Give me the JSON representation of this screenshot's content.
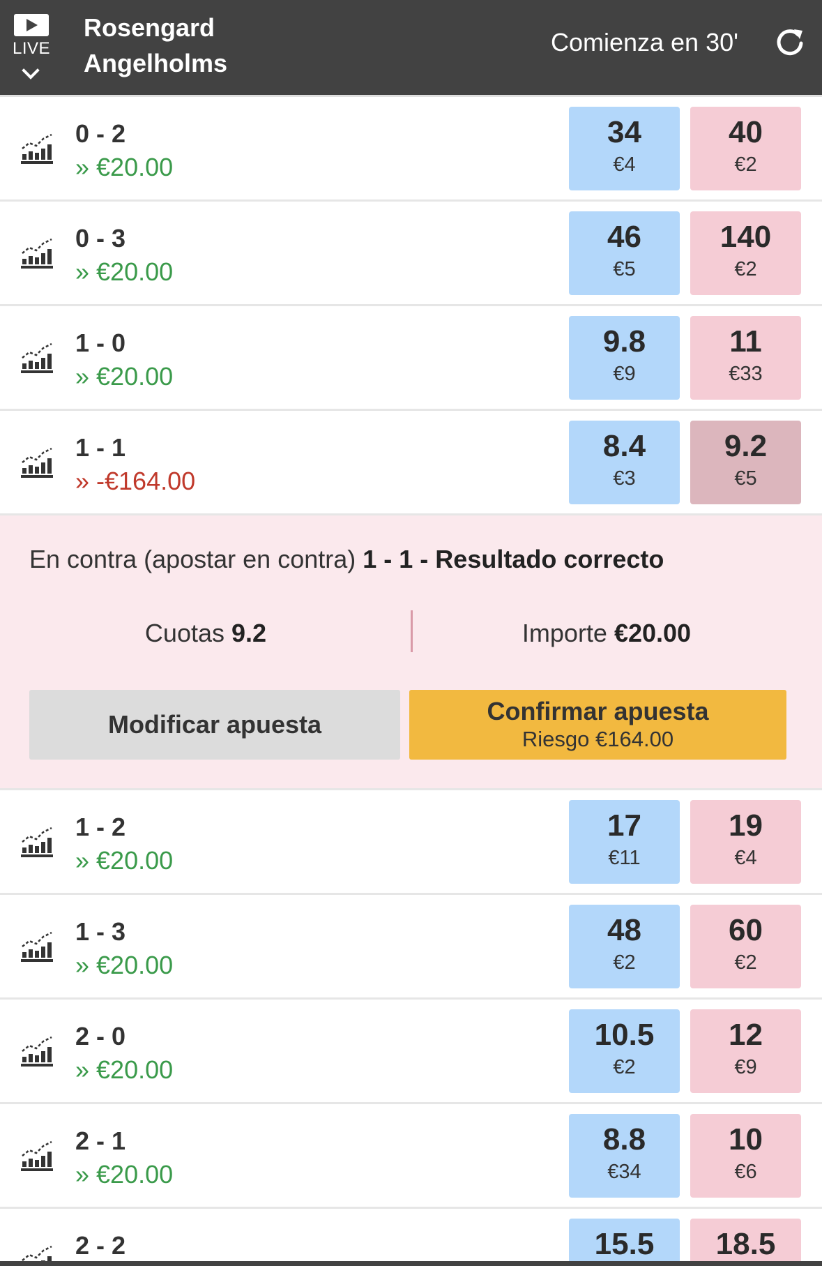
{
  "header": {
    "live_label": "LIVE",
    "team_home": "Rosengard",
    "team_away": "Angelholms",
    "starts_in": "Comienza en 30'"
  },
  "rows_top": [
    {
      "score": "0 - 2",
      "pl": "» €20.00",
      "back_price": "34",
      "back_size": "€4",
      "lay_price": "40",
      "lay_size": "€2"
    },
    {
      "score": "0 - 3",
      "pl": "» €20.00",
      "back_price": "46",
      "back_size": "€5",
      "lay_price": "140",
      "lay_size": "€2"
    },
    {
      "score": "1 - 0",
      "pl": "» €20.00",
      "back_price": "9.8",
      "back_size": "€9",
      "lay_price": "11",
      "lay_size": "€33"
    },
    {
      "score": "1 - 1",
      "pl": "» -€164.00",
      "back_price": "8.4",
      "back_size": "€3",
      "lay_price": "9.2",
      "lay_size": "€5"
    }
  ],
  "betslip": {
    "title_prefix": "En contra (apostar en contra)",
    "title_market": "1 - 1 - Resultado correcto",
    "odds_label": "Cuotas",
    "odds_value": "9.2",
    "amount_label": "Importe",
    "amount_value": "€20.00",
    "modify_label": "Modificar apuesta",
    "confirm_label": "Confirmar apuesta",
    "confirm_risk": "Riesgo €164.00"
  },
  "rows_bottom": [
    {
      "score": "1 - 2",
      "pl": "» €20.00",
      "back_price": "17",
      "back_size": "€11",
      "lay_price": "19",
      "lay_size": "€4"
    },
    {
      "score": "1 - 3",
      "pl": "» €20.00",
      "back_price": "48",
      "back_size": "€2",
      "lay_price": "60",
      "lay_size": "€2"
    },
    {
      "score": "2 - 0",
      "pl": "» €20.00",
      "back_price": "10.5",
      "back_size": "€2",
      "lay_price": "12",
      "lay_size": "€9"
    },
    {
      "score": "2 - 1",
      "pl": "» €20.00",
      "back_price": "8.8",
      "back_size": "€34",
      "lay_price": "10",
      "lay_size": "€6"
    },
    {
      "score": "2 - 2",
      "pl": "",
      "back_price": "15.5",
      "back_size": "",
      "lay_price": "18.5",
      "lay_size": ""
    }
  ],
  "icons": {
    "live": "play-icon",
    "dropdown": "chevron-down-icon",
    "refresh": "refresh-icon",
    "row_chart": "market-chart-icon"
  },
  "colors": {
    "header_bg": "#424242",
    "back": "#b3d7fa",
    "lay": "#f5ccd5",
    "lay_selected": "#dcb6bd",
    "profit": "#3a9a4a",
    "loss": "#c0392b",
    "betslip_bg": "#fbe9ed",
    "confirm": "#f2b940"
  }
}
